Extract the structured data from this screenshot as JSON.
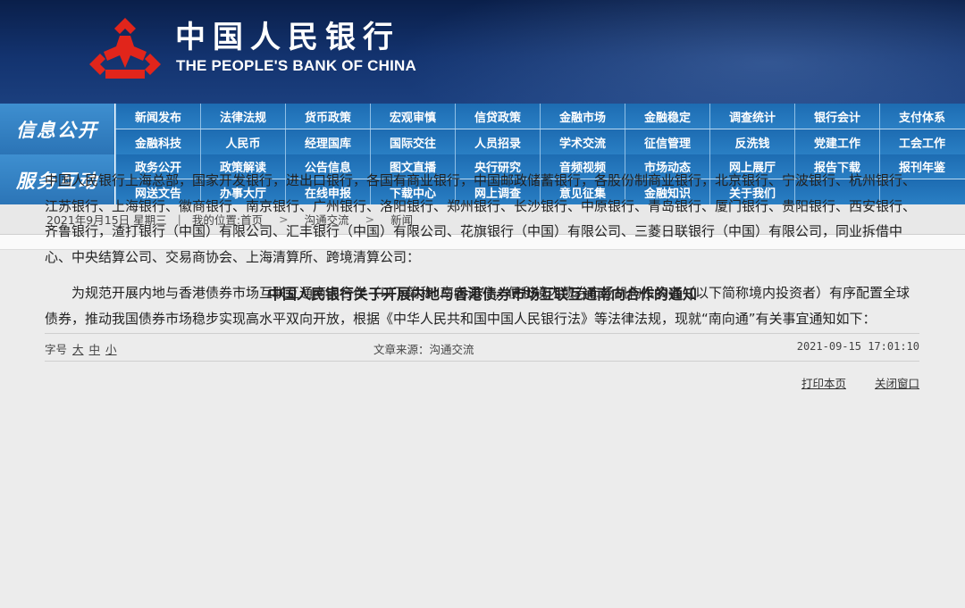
{
  "header": {
    "bank_name_cn": "中国人民银行",
    "bank_name_en": "THE PEOPLE'S BANK OF CHINA",
    "logo_icon": "pboc-logo-icon"
  },
  "nav": {
    "groups": [
      {
        "label": "信息公开",
        "row1": [
          "新闻发布",
          "法律法规",
          "货币政策",
          "宏观审慎",
          "信贷政策",
          "金融市场",
          "金融稳定",
          "调查统计",
          "银行会计",
          "支付体系"
        ],
        "row2": [
          "金融科技",
          "人民币",
          "经理国库",
          "国际交往",
          "人员招录",
          "学术交流",
          "征信管理",
          "反洗钱",
          "党建工作",
          "工会工作"
        ]
      },
      {
        "label": "服务互动",
        "row1": [
          "政务公开",
          "政策解读",
          "公告信息",
          "图文直播",
          "央行研究",
          "音频视频",
          "市场动态",
          "网上展厅",
          "报告下载",
          "报刊年鉴"
        ],
        "row2": [
          "网送文告",
          "办事大厅",
          "在线申报",
          "下载中心",
          "网上调查",
          "意见征集",
          "金融知识",
          "关于我们",
          "",
          ""
        ]
      }
    ]
  },
  "breadcrumb": {
    "date": "2021年9月15日 星期三",
    "location_label": "我的位置:首页",
    "level1": "沟通交流",
    "level2": "新闻",
    "sep": "|",
    "arrow": ">"
  },
  "article": {
    "title": "中国人民银行关于开展内地与香港债券市场互联互通南向合作的通知",
    "font_label": "字号",
    "font_large": "大",
    "font_medium": "中",
    "font_small": "小",
    "source": "文章来源：沟通交流",
    "datetime": "2021-09-15 17:01:10",
    "print_label": "打印本页",
    "close_label": "关闭窗口",
    "paragraph1": "中国人民银行上海总部，国家开发银行，进出口银行，各国有商业银行，中国邮政储蓄银行，各股份制商业银行，北京银行、宁波银行、杭州银行、江苏银行、上海银行、徽商银行、南京银行、广州银行、洛阳银行、郑州银行、长沙银行、中原银行、青岛银行、厦门银行、贵阳银行、西安银行、齐鲁银行，渣打银行（中国）有限公司、汇丰银行（中国）有限公司、花旗银行（中国）有限公司、三菱日联银行（中国）有限公司，同业拆借中心、中央结算公司、交易商协会、上海清算所、跨境清算公司：",
    "paragraph2": "为规范开展内地与香港债券市场互联互通南向合作（以下简称“南向通”），便利境内债券市场机构投资者（以下简称境内投资者）有序配置全球债券，推动我国债券市场稳步实现高水平双向开放，根据《中华人民共和国中国人民银行法》等法律法规，现就“南向通”有关事宜通知如下："
  }
}
